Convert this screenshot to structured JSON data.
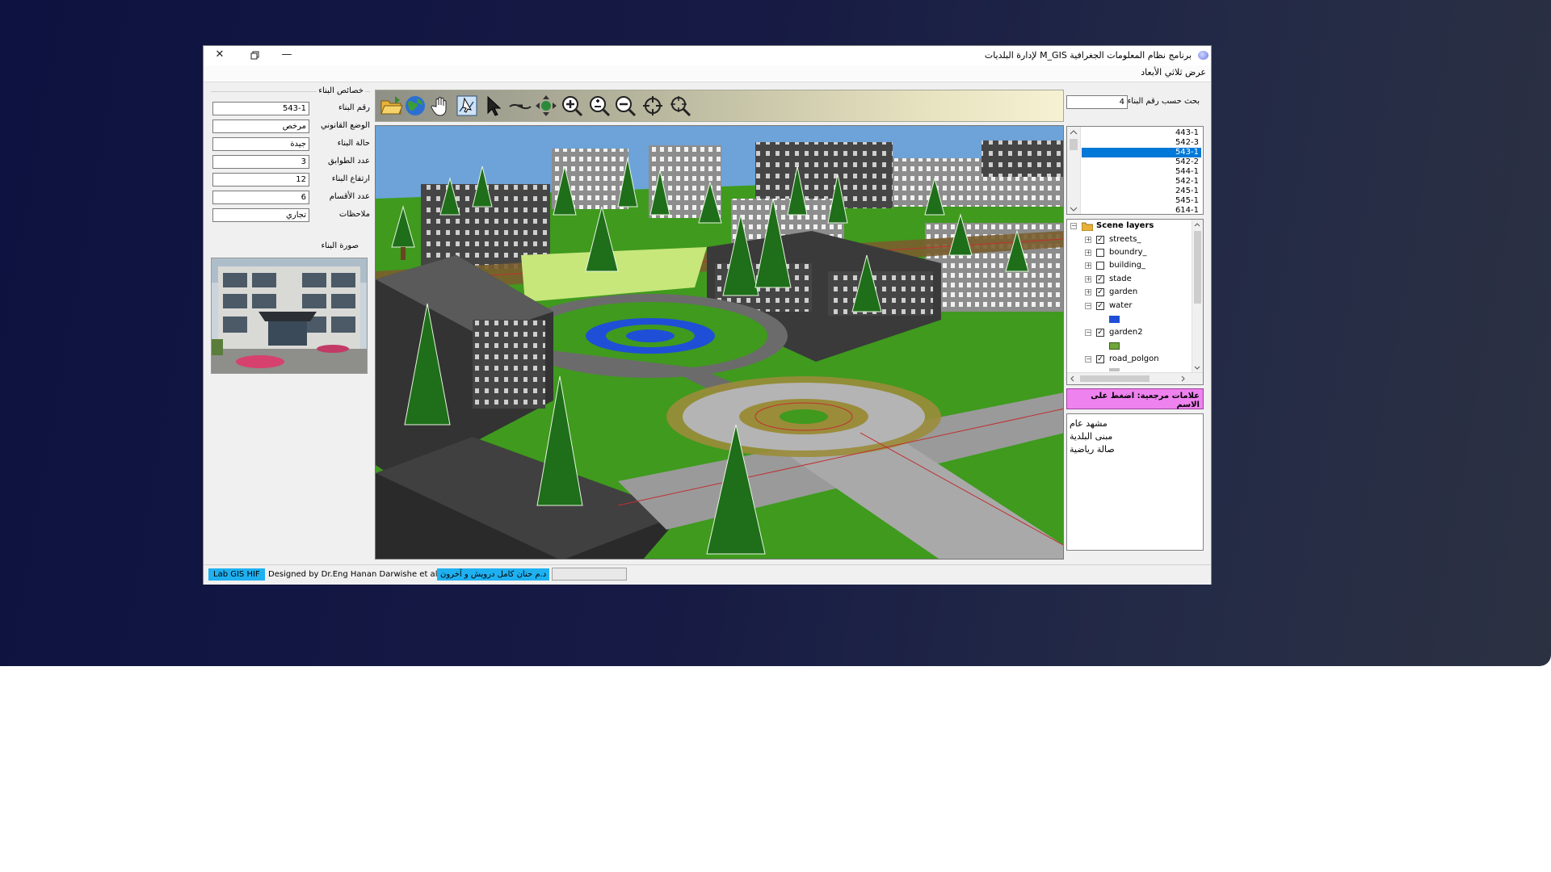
{
  "window": {
    "title": "برنامج نظام المعلومات الجغرافية M_GIS لإدارة البلديات",
    "menu": [
      "عرض ثلاثي الأبعاد"
    ]
  },
  "properties": {
    "group_title": "خصائص البناء",
    "fields": [
      {
        "label": "رقم البناء",
        "value": "543-1"
      },
      {
        "label": "الوضع القانوني",
        "value": "مرخص"
      },
      {
        "label": "حالة البناء",
        "value": "جيدة"
      },
      {
        "label": "عدد الطوابق",
        "value": "3"
      },
      {
        "label": "ارتفاع البناء",
        "value": "12"
      },
      {
        "label": "عدد الأقسام",
        "value": "6"
      },
      {
        "label": "ملاحظات",
        "value": "تجاري"
      }
    ],
    "photo_label": "صورة البناء"
  },
  "toolbar": {
    "tools": [
      {
        "icon": "open-folder-icon"
      },
      {
        "icon": "globe-icon"
      },
      {
        "icon": "pan-hand-icon"
      },
      {
        "icon": "select-features-icon"
      },
      {
        "icon": "pointer-icon"
      },
      {
        "icon": "fly-icon"
      },
      {
        "icon": "navigate-icon"
      },
      {
        "icon": "zoom-in-icon"
      },
      {
        "icon": "zoom-in-out-icon"
      },
      {
        "icon": "zoom-out-icon"
      },
      {
        "icon": "center-target-icon"
      },
      {
        "icon": "zoom-to-target-icon"
      }
    ]
  },
  "search": {
    "label": "بحث حسب رقم البناء",
    "value": "4"
  },
  "building_list": {
    "items": [
      "443-1",
      "542-3",
      "543-1",
      "542-2",
      "544-1",
      "542-1",
      "245-1",
      "545-1",
      "614-1"
    ],
    "selected_index": 2
  },
  "layers": {
    "root": "Scene layers",
    "items": [
      {
        "name": "streets_",
        "checked": true,
        "expanded": false
      },
      {
        "name": "boundry_",
        "checked": false,
        "expanded": false
      },
      {
        "name": "building_",
        "checked": false,
        "expanded": false
      },
      {
        "name": "stade",
        "checked": true,
        "expanded": false
      },
      {
        "name": "garden",
        "checked": true,
        "expanded": false
      },
      {
        "name": "water",
        "checked": true,
        "expanded": true,
        "swatch": "#1f4fd6"
      },
      {
        "name": "garden2",
        "checked": true,
        "expanded": true,
        "swatch": "#6fa63a"
      },
      {
        "name": "road_polgon",
        "checked": true,
        "expanded": true,
        "swatch": "#c0c0c0"
      }
    ]
  },
  "bookmarks": {
    "header": "علامات مرجعية: اضغط على الاسم",
    "items": [
      "مشهد عام",
      "مبنى البلدية",
      "صالة رياضية"
    ]
  },
  "statusbar": {
    "lab": "Lab GIS HIF",
    "designed_by": "Designed by Dr.Eng Hanan Darwishe et al.",
    "arabic_credit": "د.م حنان كامل درويش و آخرون"
  },
  "colors": {
    "selection": "#0078d7",
    "bookmark_header": "#ee82ee",
    "status_highlight": "#1fb0f0",
    "grass": "#3f9a1e"
  }
}
